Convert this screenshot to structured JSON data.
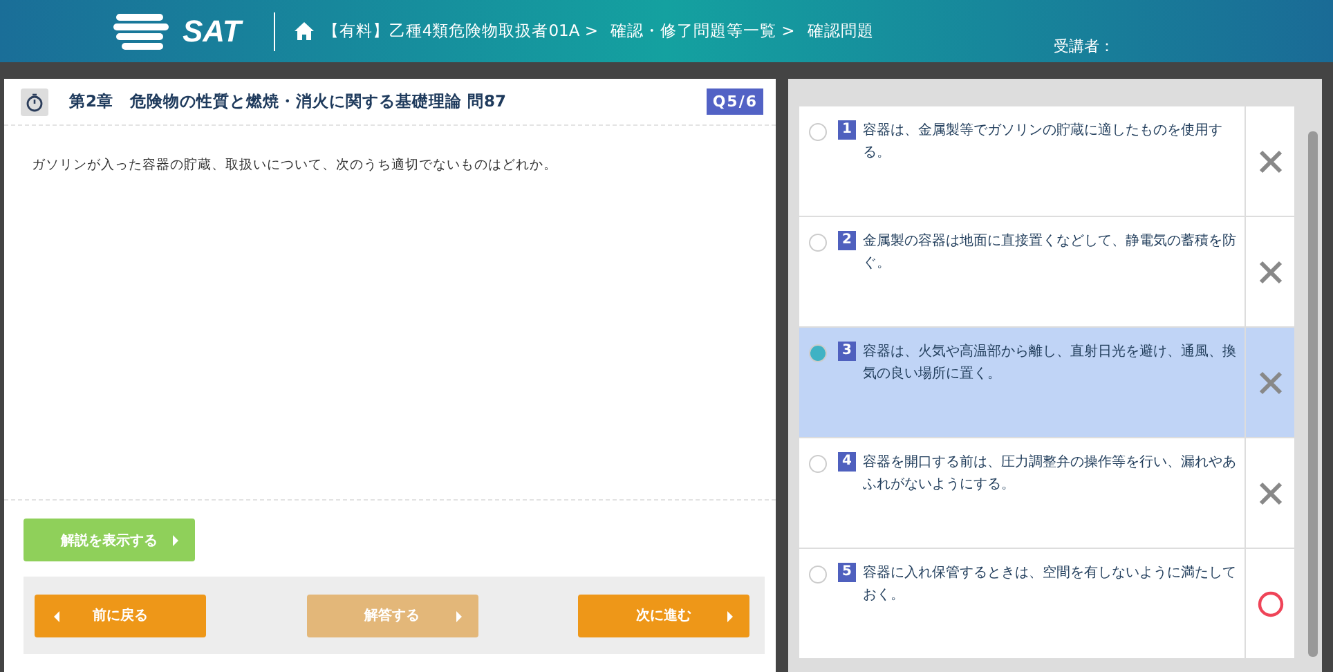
{
  "header": {
    "logo": "SAT",
    "breadcrumbs": [
      "【有料】乙種4類危険物取扱者01A >",
      "確認・修了問題等一覧 >",
      "確認問題"
    ],
    "user_label": "受講者："
  },
  "question": {
    "title": "第2章　危険物の性質と燃焼・消火に関する基礎理論 問87",
    "counter": "Q5/6",
    "text": "ガソリンが入った容器の貯蔵、取扱いについて、次のうち適切でないものはどれか。"
  },
  "explain_button": {
    "label": "解説を表示する",
    "disabled": false
  },
  "nav_buttons": [
    {
      "label": "前に戻る",
      "kind": "back",
      "disabled": false
    },
    {
      "label": "解答する",
      "kind": "forward",
      "disabled": true
    },
    {
      "label": "次に進む",
      "kind": "forward",
      "disabled": false
    }
  ],
  "choices": [
    {
      "number": "1",
      "text": "容器は、金属製等でガソリンの貯蔵に適したものを使用する。",
      "selected": false,
      "kind": "wrong"
    },
    {
      "number": "2",
      "text": "金属製の容器は地面に直接置くなどして、静電気の蓄積を防ぐ。",
      "selected": false,
      "kind": "wrong"
    },
    {
      "number": "3",
      "text": "容器は、火気や高温部から離し、直射日光を避け、通風、換気の良い場所に置く。",
      "selected": true,
      "kind": "wrong"
    },
    {
      "number": "4",
      "text": "容器を開口する前は、圧力調整弁の操作等を行い、漏れやあふれがないようにする。",
      "selected": false,
      "kind": "wrong"
    },
    {
      "number": "5",
      "text": "容器に入れ保管するときは、空間を有しないように満たしておく。",
      "selected": false,
      "kind": "correct"
    }
  ]
}
